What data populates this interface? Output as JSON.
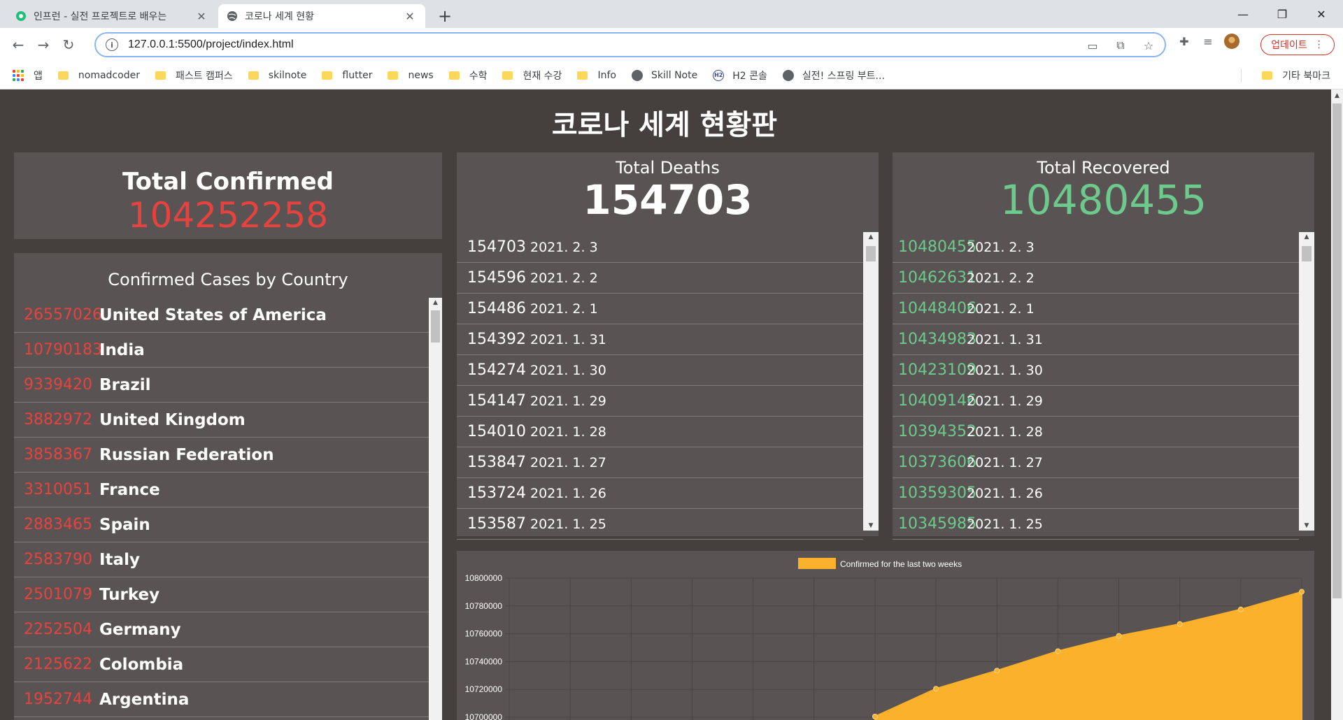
{
  "browser": {
    "tabs": [
      {
        "title": "인프런 - 실전 프로젝트로 배우는",
        "active": false
      },
      {
        "title": "코로나 세계 현황",
        "active": true
      }
    ],
    "url": "127.0.0.1:5500/project/index.html",
    "update_label": "업데이트",
    "bookmarks": [
      {
        "label": "앱",
        "icon": "apps-grid-icon"
      },
      {
        "label": "nomadcoder",
        "icon": "folder-icon"
      },
      {
        "label": "패스트 캠퍼스",
        "icon": "folder-icon"
      },
      {
        "label": "skilnote",
        "icon": "folder-icon"
      },
      {
        "label": "flutter",
        "icon": "folder-icon"
      },
      {
        "label": "news",
        "icon": "folder-icon"
      },
      {
        "label": "수학",
        "icon": "folder-icon"
      },
      {
        "label": "현재 수강",
        "icon": "folder-icon"
      },
      {
        "label": "Info",
        "icon": "folder-icon"
      },
      {
        "label": "Skill Note",
        "icon": "globe-icon"
      },
      {
        "label": "H2 콘솔",
        "icon": "h2-icon"
      },
      {
        "label": "실전! 스프링 부트...",
        "icon": "globe-icon"
      }
    ],
    "other_bookmarks": "기타 북마크"
  },
  "page": {
    "title": "코로나 세계 현황판",
    "confirmed": {
      "label": "Total Confirmed",
      "value": "104252258"
    },
    "deaths": {
      "label": "Total Deaths",
      "value": "154703"
    },
    "recovered": {
      "label": "Total Recovered",
      "value": "10480455"
    },
    "countries_title": "Confirmed Cases by Country",
    "countries": [
      {
        "count": "26557026",
        "name": "United States of America"
      },
      {
        "count": "10790183",
        "name": "India"
      },
      {
        "count": "9339420",
        "name": "Brazil"
      },
      {
        "count": "3882972",
        "name": "United Kingdom"
      },
      {
        "count": "3858367",
        "name": "Russian Federation"
      },
      {
        "count": "3310051",
        "name": "France"
      },
      {
        "count": "2883465",
        "name": "Spain"
      },
      {
        "count": "2583790",
        "name": "Italy"
      },
      {
        "count": "2501079",
        "name": "Turkey"
      },
      {
        "count": "2252504",
        "name": "Germany"
      },
      {
        "count": "2125622",
        "name": "Colombia"
      },
      {
        "count": "1952744",
        "name": "Argentina"
      }
    ],
    "deaths_list": [
      {
        "count": "154703",
        "date": "2021. 2. 3"
      },
      {
        "count": "154596",
        "date": "2021. 2. 2"
      },
      {
        "count": "154486",
        "date": "2021. 2. 1"
      },
      {
        "count": "154392",
        "date": "2021. 1. 31"
      },
      {
        "count": "154274",
        "date": "2021. 1. 30"
      },
      {
        "count": "154147",
        "date": "2021. 1. 29"
      },
      {
        "count": "154010",
        "date": "2021. 1. 28"
      },
      {
        "count": "153847",
        "date": "2021. 1. 27"
      },
      {
        "count": "153724",
        "date": "2021. 1. 26"
      },
      {
        "count": "153587",
        "date": "2021. 1. 25"
      }
    ],
    "recovered_list": [
      {
        "count": "10480455",
        "date": "2021. 2. 3"
      },
      {
        "count": "10462631",
        "date": "2021. 2. 2"
      },
      {
        "count": "10448406",
        "date": "2021. 2. 1"
      },
      {
        "count": "10434983",
        "date": "2021. 1. 31"
      },
      {
        "count": "10423109",
        "date": "2021. 1. 30"
      },
      {
        "count": "10409146",
        "date": "2021. 1. 29"
      },
      {
        "count": "10394352",
        "date": "2021. 1. 28"
      },
      {
        "count": "10373606",
        "date": "2021. 1. 27"
      },
      {
        "count": "10359305",
        "date": "2021. 1. 26"
      },
      {
        "count": "10345985",
        "date": "2021. 1. 25"
      }
    ]
  },
  "chart_data": {
    "type": "area",
    "series": [
      {
        "name": "Confirmed for the last two weeks",
        "color": "#fbb12b",
        "points": [
          [
            7,
            10700500
          ],
          [
            8,
            10720500
          ],
          [
            9,
            10733500
          ],
          [
            10,
            10747500
          ],
          [
            11,
            10758500
          ],
          [
            12,
            10767000
          ],
          [
            13,
            10777500
          ],
          [
            14,
            10790183
          ]
        ]
      }
    ],
    "yticks": [
      "10800000",
      "10780000",
      "10760000",
      "10740000",
      "10720000",
      "10700000"
    ],
    "ylim": [
      10700000,
      10800000
    ],
    "xlim": [
      1,
      14
    ],
    "legend": "top-center",
    "grid": true
  },
  "colors": {
    "background": "#453f3e",
    "panel": "#595453",
    "confirmed": "#e8423f",
    "recovered": "#6ec98c",
    "deaths": "#ffffff"
  }
}
